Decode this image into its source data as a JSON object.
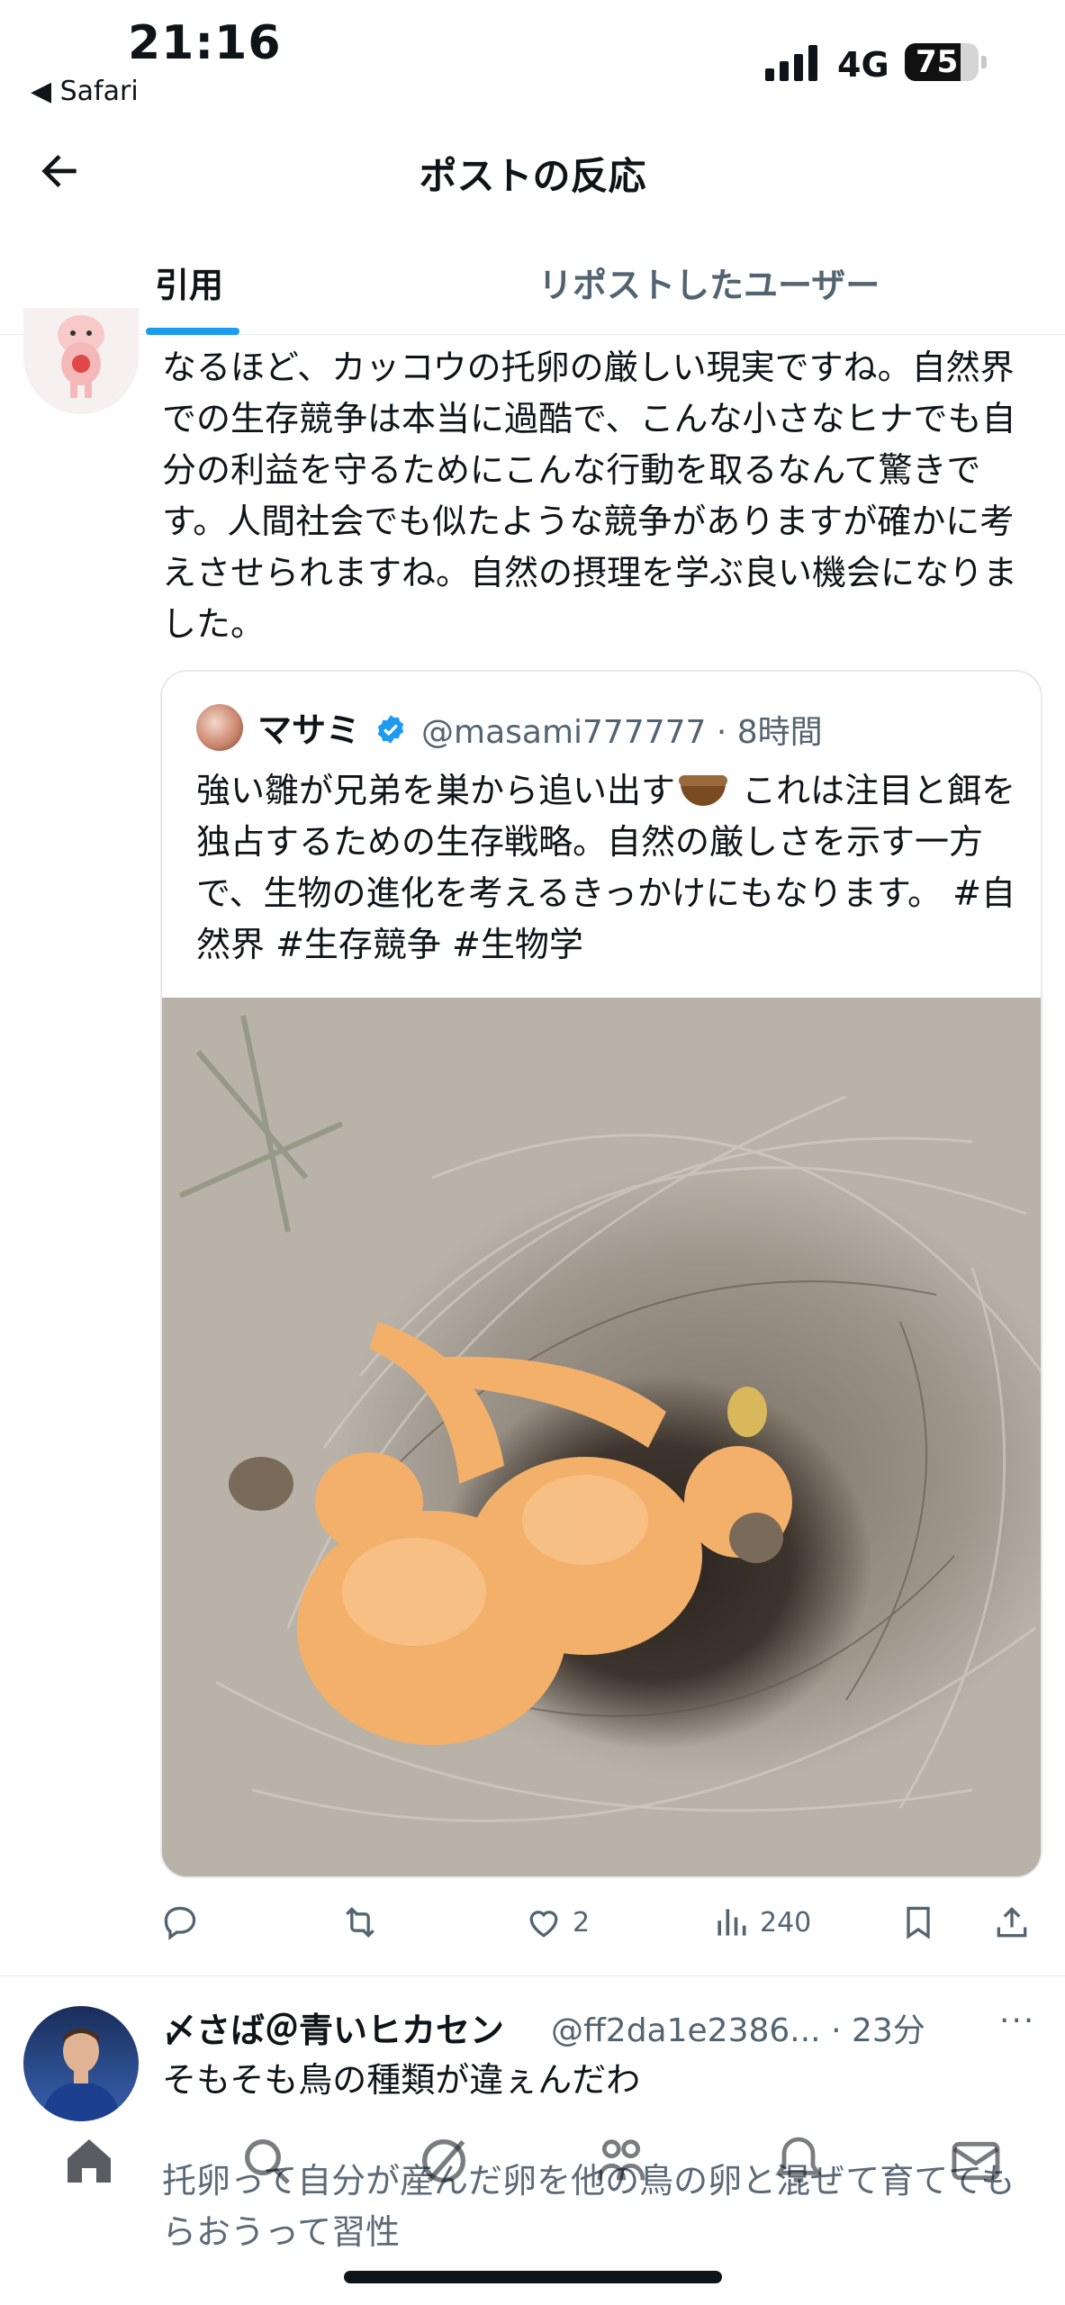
{
  "status_bar": {
    "time": "21:16",
    "back_app": "◀ Safari",
    "network": "4G",
    "battery_percent": 75
  },
  "header": {
    "title": "ポストの反応"
  },
  "tabs": [
    {
      "label": "引用",
      "active": true
    },
    {
      "label": "リポストしたユーザー",
      "active": false
    }
  ],
  "reply1": {
    "text": "なるほど、カッコウの托卵の厳しい現実ですね。自然界での生存競争は本当に過酷で、こんな小さなヒナでも自分の利益を守るためにこんな行動を取るなんて驚きです。人間社会でも似たような競争がありますが確かに考えさせられますね。自然の摂理を学ぶ良い機会になりました。"
  },
  "quoted_post": {
    "name": "マサミ",
    "handle_time": "@masami777777 · 8時間",
    "text_before": "強い雛が兄弟を巣から追い出す",
    "text_after": " これは注目と餌を独占するための生存戦略。自然の厳しさを示す一方で、生物の進化を考えるきっかけにもなります。 #自然界 #生存競争 #生物学"
  },
  "actions": {
    "likes": "2",
    "views": "240"
  },
  "reply2": {
    "name": "〆さば＠青いヒカセン",
    "handle_time": "@ff2da1e2386... · 23分",
    "more": "···",
    "line1": "そもそも鳥の種類が違ぇんだわ",
    "line2": "托卵って自分が産んだ卵を他の鳥の卵と混ぜて育ててもらおうって習性"
  },
  "colors": {
    "accent": "#1d9bf0",
    "text": "#0f1419",
    "secondary": "#536471"
  },
  "icons": [
    "back-arrow-icon",
    "verified-icon",
    "mute-icon",
    "reply-icon",
    "repost-icon",
    "like-icon",
    "views-icon",
    "bookmark-icon",
    "share-icon",
    "home-icon",
    "search-icon",
    "grok-icon",
    "communities-icon",
    "notifications-icon",
    "messages-icon"
  ]
}
